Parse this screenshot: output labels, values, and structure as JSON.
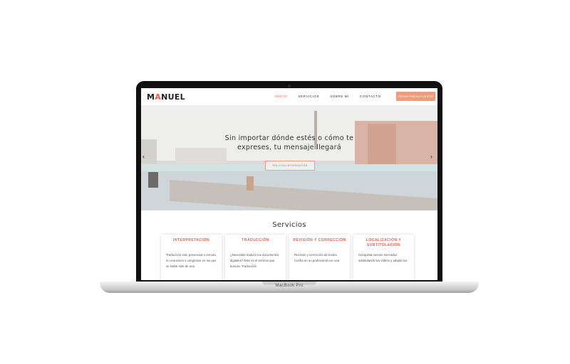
{
  "site": {
    "logo_prefix": "M",
    "logo_accent": "A",
    "logo_suffix": "NUEL",
    "nav": [
      {
        "label": "INICIO",
        "active": true
      },
      {
        "label": "SERVICIOS",
        "active": false
      },
      {
        "label": "SOBRE MÍ",
        "active": false
      },
      {
        "label": "CONTACTO",
        "active": false
      }
    ],
    "cta_label": "PEDIR PRESUPUESTO"
  },
  "hero": {
    "title_line1": "Sin importar dónde estés o cómo te",
    "title_line2": "expreses, tu mensaje llegará",
    "button_label": "SOLICITA INFORMACIÓN",
    "prev_arrow": "‹",
    "next_arrow": "›"
  },
  "services": {
    "heading": "Servicios",
    "cards": [
      {
        "title": "INTERPRETACIÓN",
        "text": "Traducción oral, presencial o remota, en reuniones o congresos en los que se hable más de una"
      },
      {
        "title": "TRADUCCIÓN",
        "text": "¿Necesitas traducir tus documentos digitales? Este es el servicio que buscas. Traducción"
      },
      {
        "title": "REVISIÓN Y CORRECCIÓN",
        "text": "Revisión y corrección de textos. Confía en un profesional con una"
      },
      {
        "title": "LOCALIZACIÓN Y SUBTITULACIÓN",
        "text": "Conquista nuevos mercados subtitulando tus vídeos y adapta tus"
      }
    ]
  },
  "device": {
    "label": "MacBook Pro"
  },
  "colors": {
    "accent": "#e8604c",
    "cta": "#f19a7d"
  }
}
